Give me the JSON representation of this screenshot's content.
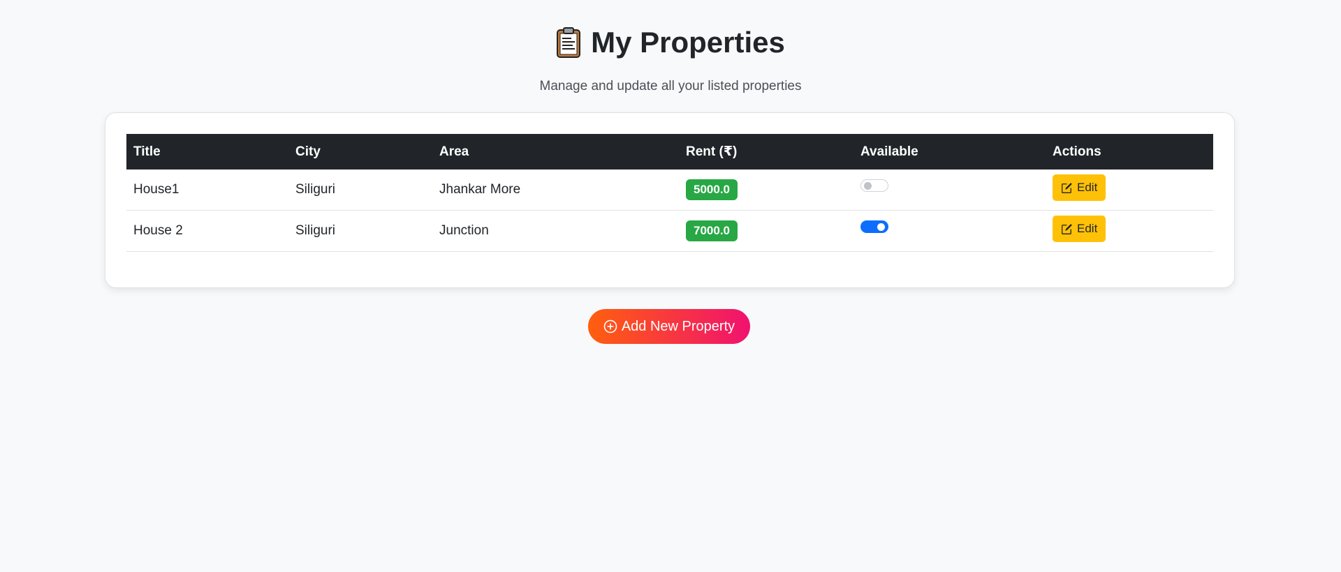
{
  "header": {
    "title": "My Properties",
    "subtitle": "Manage and update all your listed properties",
    "title_icon": "clipboard-icon"
  },
  "table": {
    "columns": [
      "Title",
      "City",
      "Area",
      "Rent (₹)",
      "Available",
      "Actions"
    ],
    "rows": [
      {
        "title": "House1",
        "city": "Siliguri",
        "area": "Jhankar More",
        "rent": "5000.0",
        "available": false,
        "action_label": "Edit"
      },
      {
        "title": "House 2",
        "city": "Siliguri",
        "area": "Junction",
        "rent": "7000.0",
        "available": true,
        "action_label": "Edit"
      }
    ]
  },
  "add_button": {
    "label": "Add New Property",
    "icon": "plus-circle-icon"
  },
  "colors": {
    "background": "#f8f9fa",
    "table_header": "#212529",
    "rent_badge": "#28a745",
    "toggle_on": "#0d6efd",
    "edit_button": "#ffc107",
    "add_gradient_start": "#ff5f0e",
    "add_gradient_end": "#f0126f"
  }
}
